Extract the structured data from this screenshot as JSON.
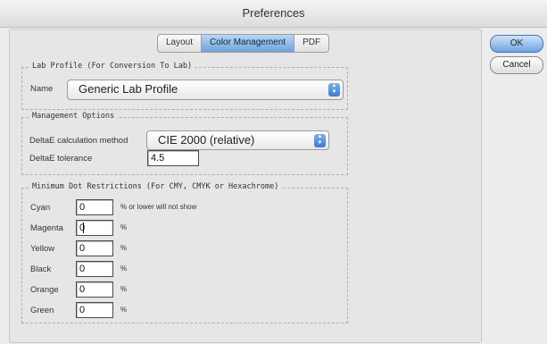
{
  "window": {
    "title": "Preferences"
  },
  "tabs": [
    {
      "label": "Layout",
      "active": false
    },
    {
      "label": "Color Management",
      "active": true
    },
    {
      "label": "PDF",
      "active": false
    }
  ],
  "buttons": {
    "ok": "OK",
    "cancel": "Cancel"
  },
  "lab_profile": {
    "legend": "Lab Profile (For Conversion To Lab)",
    "name_label": "Name",
    "name_value": "Generic Lab Profile"
  },
  "management": {
    "legend": "Management Options",
    "method_label": "DeltaE calculation method",
    "method_value": "CIE 2000 (relative)",
    "tolerance_label": "DeltaE tolerance",
    "tolerance_value": "4.5"
  },
  "min_dot": {
    "legend": "Minimum Dot Restrictions (For CMY, CMYK or Hexachrome)",
    "rows": [
      {
        "label": "Cyan",
        "value": "0",
        "suffix": "% or lower will not show"
      },
      {
        "label": "Magenta",
        "value": "0",
        "suffix": "%"
      },
      {
        "label": "Yellow",
        "value": "0",
        "suffix": "%"
      },
      {
        "label": "Black",
        "value": "0",
        "suffix": "%"
      },
      {
        "label": "Orange",
        "value": "0",
        "suffix": "%"
      },
      {
        "label": "Green",
        "value": "0",
        "suffix": "%"
      }
    ]
  },
  "colors": {
    "accent": "#6fa3d9",
    "window_bg": "#ececec"
  }
}
